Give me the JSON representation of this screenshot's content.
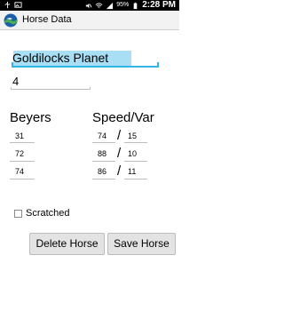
{
  "status_bar": {
    "time": "2:28 PM",
    "battery": "95%"
  },
  "action_bar": {
    "title": "Horse Data",
    "logo_icon": "app-logo-icon"
  },
  "form": {
    "horse_name": "Goldilocks Planet",
    "horse_number": "4"
  },
  "labels": {
    "beyers": "Beyers",
    "speed_var": "Speed/Var",
    "slash": "/"
  },
  "rows": [
    {
      "beyer": "31",
      "speed": "74",
      "var": "15"
    },
    {
      "beyer": "72",
      "speed": "88",
      "var": "10"
    },
    {
      "beyer": "74",
      "speed": "86",
      "var": "11"
    }
  ],
  "scratched": {
    "label": "Scratched",
    "checked": false
  },
  "buttons": {
    "delete": "Delete Horse",
    "save": "Save Horse"
  },
  "colors": {
    "accent": "#33b5e5",
    "selection": "#a8dff5",
    "status_bar": "#000000",
    "action_bar": "#f2f2f2"
  }
}
